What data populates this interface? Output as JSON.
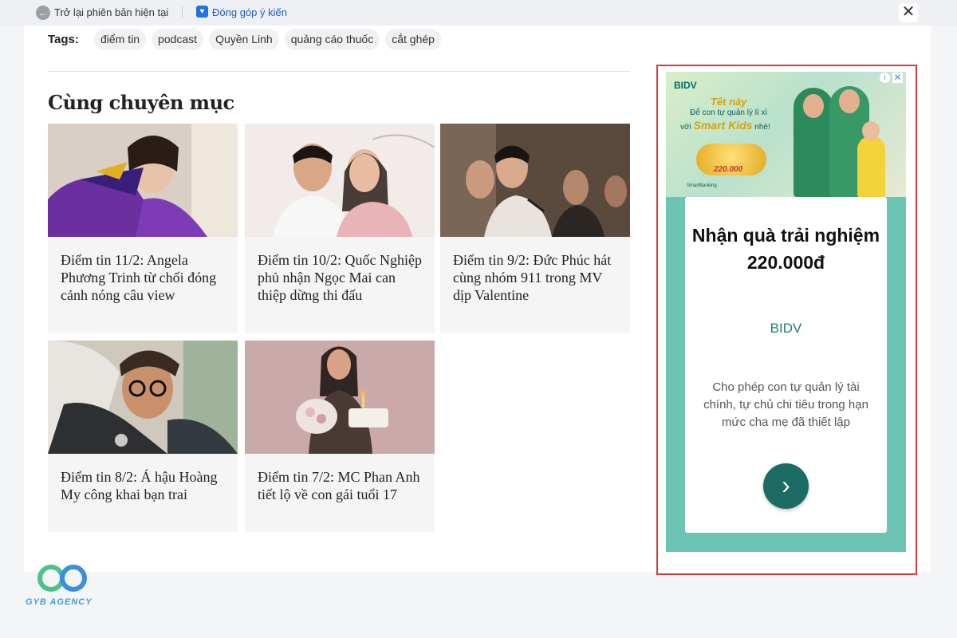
{
  "topbar": {
    "back_label": "Trở lại phiên bản hiện tại",
    "feedback_label": "Đóng góp ý kiến",
    "close_symbol": "✕"
  },
  "tags": {
    "label": "Tags:",
    "items": [
      "điểm tin",
      "podcast",
      "Quyền Linh",
      "quảng cáo thuốc",
      "cắt ghép"
    ]
  },
  "section_title": "Cùng chuyên mục",
  "articles": [
    {
      "title": "Điểm tin 11/2: Angela Phương Trinh từ chối đóng cảnh nóng câu view"
    },
    {
      "title": "Điểm tin 10/2: Quốc Nghiệp phủ nhận Ngọc Mai can thiệp dừng thi đấu"
    },
    {
      "title": "Điểm tin 9/2: Đức Phúc hát cùng nhóm 911 trong MV dịp Valentine"
    },
    {
      "title": "Điểm tin 8/2: Á hậu Hoàng My công khai bạn trai"
    },
    {
      "title": "Điểm tin 7/2: MC Phan Anh tiết lộ về con gái tuổi 17"
    }
  ],
  "ad": {
    "brand": "BIDV",
    "banner_tet": "Tết này",
    "banner_line1": "Để con tự quản lý lì xì",
    "banner_line2_prefix": "với",
    "banner_smartkids": "Smart Kids",
    "banner_line2_suffix": "nhé!",
    "banner_gold_amount": "220.000",
    "banner_smartbanking": "SmartBanking",
    "headline": "Nhận quà trải nghiệm 220.000đ",
    "description": "Cho phép con tự quản lý tài chính, tự chủ chi tiêu trong hạn mức cha mẹ đã thiết lập",
    "info_symbol": "i",
    "close_symbol": "✕",
    "arrow_symbol": "›"
  },
  "watermark": {
    "text": "GYB AGENCY"
  },
  "colors": {
    "accent_red": "#d93b3b",
    "ad_teal": "#6cc4b4",
    "ad_button": "#1b6c65",
    "link_blue": "#1a5fc7"
  }
}
